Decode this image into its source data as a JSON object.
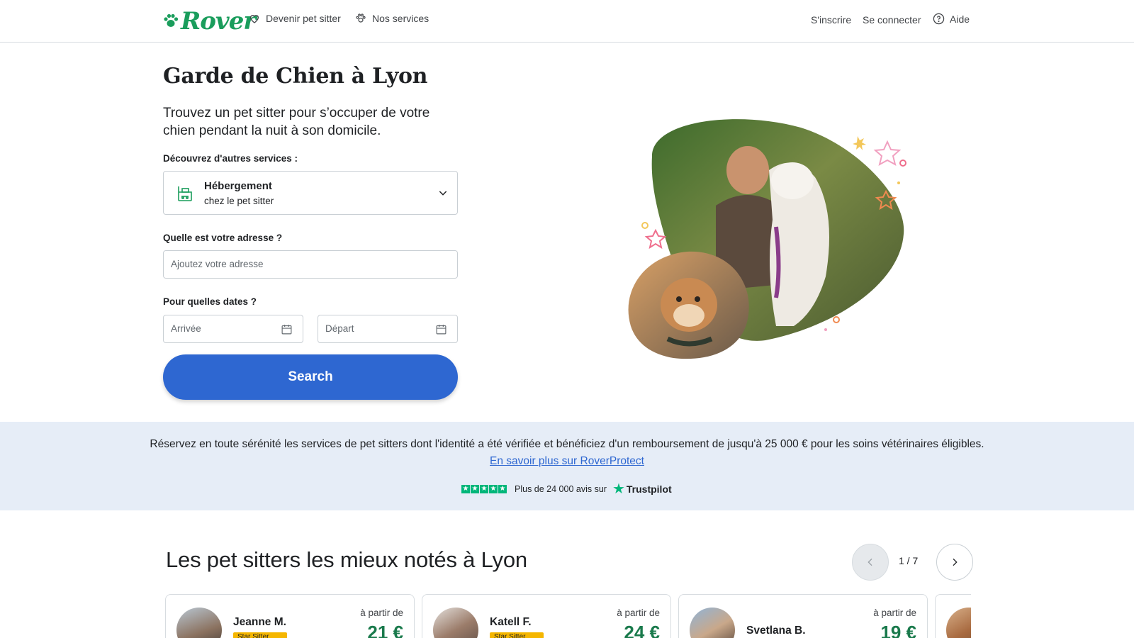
{
  "header": {
    "logo": "Rover",
    "nav": [
      {
        "label": "Devenir pet sitter",
        "icon": "heart-icon"
      },
      {
        "label": "Nos services",
        "icon": "paw-icon"
      }
    ],
    "signup": "S'inscrire",
    "login": "Se connecter",
    "help": "Aide"
  },
  "hero": {
    "title": "Garde de Chien à Lyon",
    "subtitle": "Trouvez un pet sitter pour s’occuper de votre chien pendant la nuit à son domicile.",
    "services_label": "Découvrez d'autres services :",
    "service": {
      "name": "Hébergement",
      "desc": "chez le pet sitter",
      "icon": "boarding-icon"
    },
    "address_label": "Quelle est votre adresse ?",
    "address_placeholder": "Ajoutez votre adresse",
    "dates_label": "Pour quelles dates ?",
    "arrival_placeholder": "Arrivée",
    "departure_placeholder": "Départ",
    "search_label": "Search"
  },
  "protect": {
    "text": "Réservez en toute sérénité les services de pet sitters dont l'identité a été vérifiée et bénéficiez d'un remboursement de jusqu'à 25 000 € pour les soins vétérinaires éligibles.",
    "link": "En savoir plus sur RoverProtect",
    "reviews": "Plus de 24 000 avis sur",
    "brand": "Trustpilot"
  },
  "sitters": {
    "title": "Les pet sitters les mieux notés à Lyon",
    "page": "1 / 7",
    "cards": [
      {
        "name": "Jeanne M.",
        "badge": "Star Sitter",
        "from": "à partir de",
        "price": "21 €"
      },
      {
        "name": "Katell F.",
        "badge": "Star Sitter",
        "from": "à partir de",
        "price": "24 €"
      },
      {
        "name": "Svetlana B.",
        "from": "à partir de",
        "price": "19 €"
      }
    ]
  },
  "colors": {
    "brand_green": "#1a9d5c",
    "primary_blue": "#2e67d1",
    "banner_bg": "#e6edf7",
    "trustpilot_green": "#00b67a",
    "badge_yellow": "#f5b600"
  }
}
